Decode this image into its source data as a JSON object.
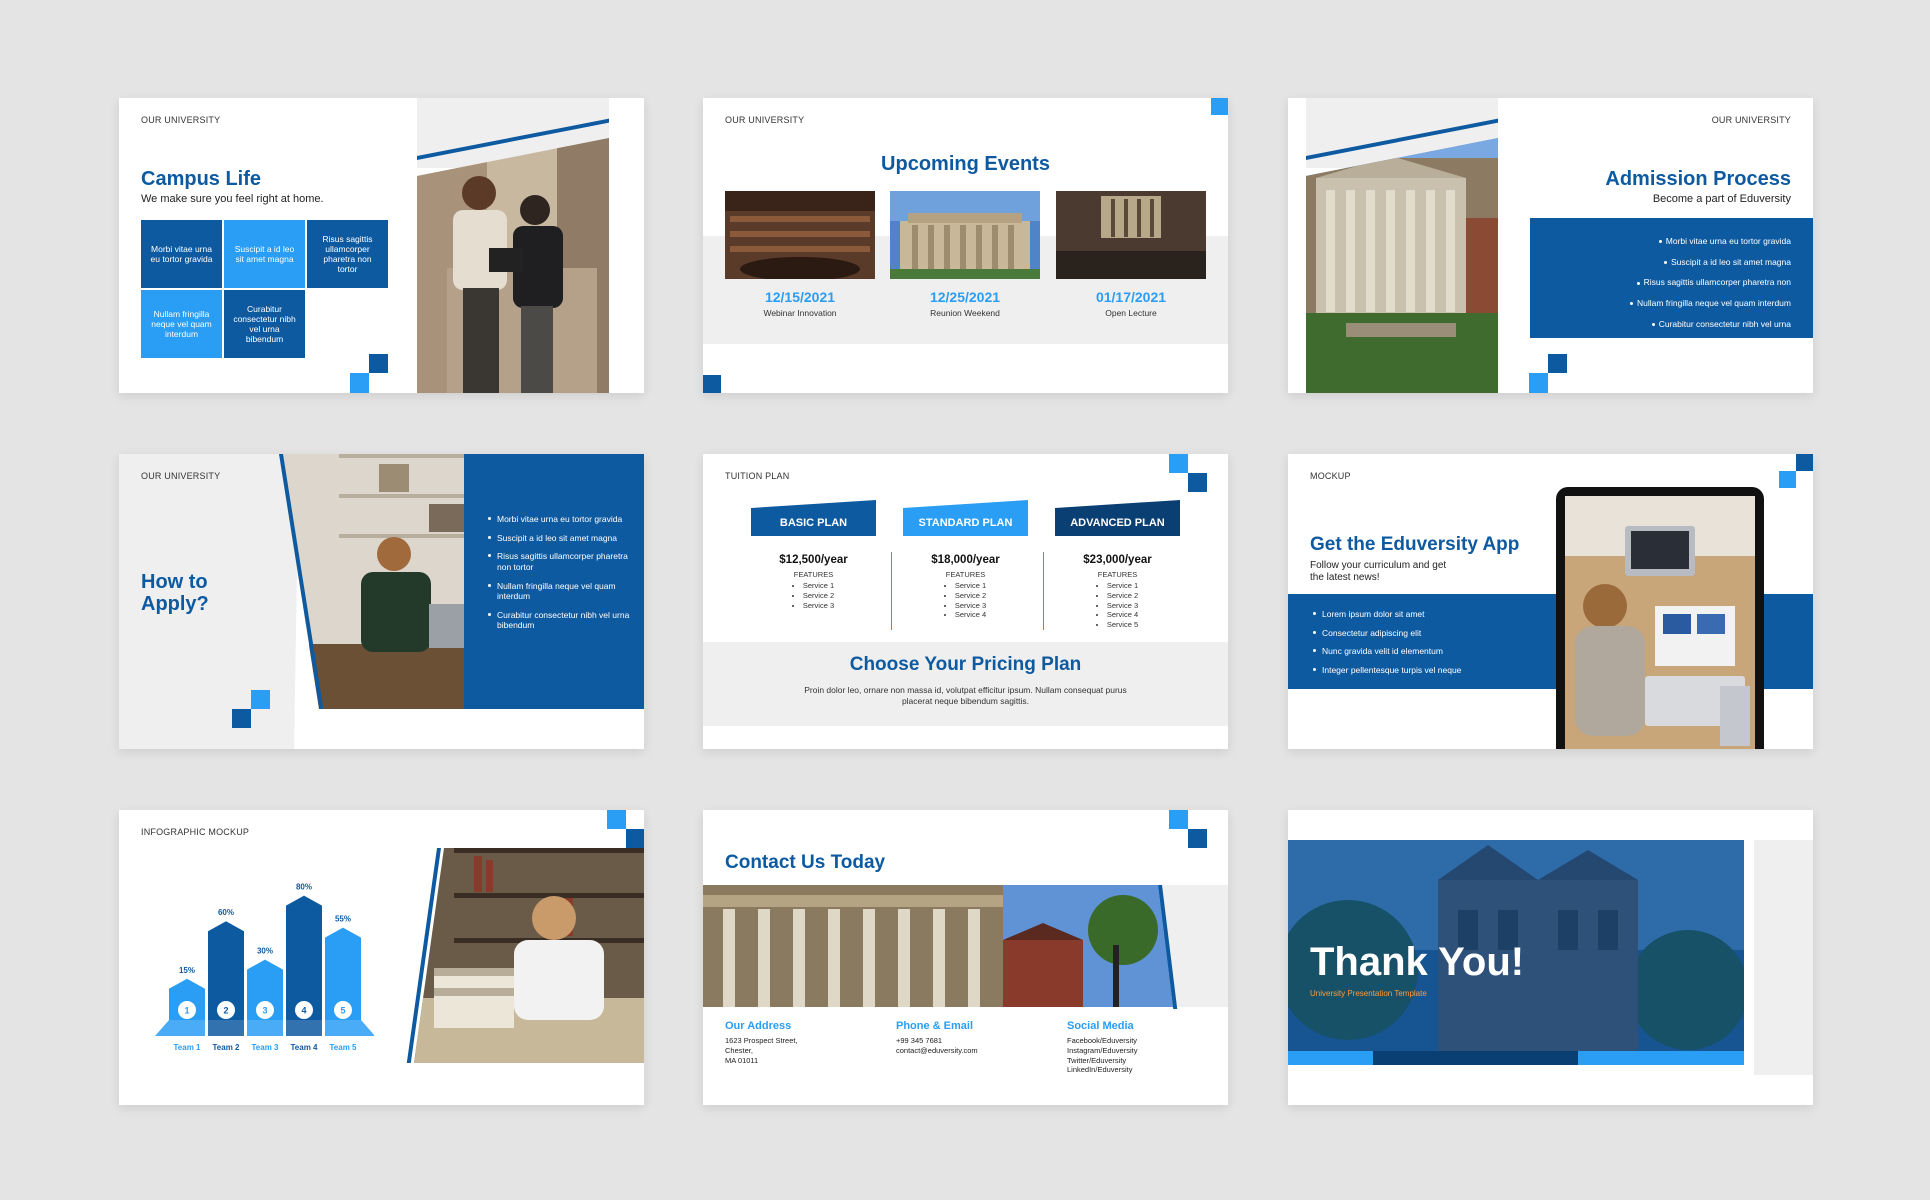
{
  "colors": {
    "dark_blue": "#0e5aa1",
    "light_blue": "#2a9df4",
    "gray": "#efefef",
    "background": "#e4e4e4"
  },
  "s1": {
    "label": "OUR UNIVERSITY",
    "title": "Campus Life",
    "subtitle": "We make sure you feel right at home.",
    "cells": [
      "Morbi vitae urna eu tortor gravida",
      "Suscipit a id leo sit amet magna",
      "Risus sagittis ullamcorper pharetra non tortor",
      "Nullam fringilla neque vel quam interdum",
      "Curabitur consectetur nibh vel urna bibendum"
    ]
  },
  "s2": {
    "label": "OUR UNIVERSITY",
    "title": "Upcoming Events",
    "events": [
      {
        "date": "12/15/2021",
        "name": "Webinar Innovation"
      },
      {
        "date": "12/25/2021",
        "name": "Reunion Weekend"
      },
      {
        "date": "01/17/2021",
        "name": "Open Lecture"
      }
    ]
  },
  "s3": {
    "label": "OUR UNIVERSITY",
    "title": "Admission Process",
    "subtitle": "Become a part of Eduversity",
    "bullets": [
      "Morbi vitae urna eu tortor gravida",
      "Suscipit a id leo sit amet magna",
      "Risus sagittis ullamcorper pharetra non",
      "Nullam fringilla neque vel quam interdum",
      "Curabitur consectetur nibh vel urna"
    ]
  },
  "s4": {
    "label": "OUR UNIVERSITY",
    "title_line1": "How to",
    "title_line2": "Apply?",
    "bullets": [
      "Morbi vitae urna eu tortor gravida",
      "Suscipit a id leo sit amet magna",
      "Risus sagittis ullamcorper pharetra non tortor",
      "Nullam fringilla neque vel quam interdum",
      "Curabitur consectetur nibh vel urna bibendum"
    ]
  },
  "s5": {
    "label": "TUITION PLAN",
    "features_label": "FEATURES",
    "plans": [
      {
        "name": "BASIC PLAN",
        "price": "$12,500/year",
        "services": [
          "Service 1",
          "Service 2",
          "Service 3"
        ]
      },
      {
        "name": "STANDARD PLAN",
        "price": "$18,000/year",
        "services": [
          "Service 1",
          "Service 2",
          "Service 3",
          "Service 4"
        ]
      },
      {
        "name": "ADVANCED PLAN",
        "price": "$23,000/year",
        "services": [
          "Service 1",
          "Service 2",
          "Service 3",
          "Service 4",
          "Service 5"
        ]
      }
    ],
    "heading": "Choose Your Pricing Plan",
    "body": "Proin dolor leo, ornare non massa id, volutpat efficitur ipsum. Nullam consequat purus placerat neque bibendum sagittis."
  },
  "s6": {
    "label": "MOCKUP",
    "title": "Get the Eduversity App",
    "subtitle_line1": "Follow your curriculum and get",
    "subtitle_line2": "the latest news!",
    "bullets": [
      "Lorem ipsum dolor sit amet",
      "Consectetur adipiscing elit",
      "Nunc gravida velit id elementum",
      "Integer pellentesque turpis vel neque"
    ]
  },
  "s7": {
    "label": "INFOGRAPHIC MOCKUP",
    "bars": [
      {
        "team": "Team 1",
        "value": 15,
        "num": "1"
      },
      {
        "team": "Team 2",
        "value": 60,
        "num": "2"
      },
      {
        "team": "Team 3",
        "value": 30,
        "num": "3"
      },
      {
        "team": "Team 4",
        "value": 80,
        "num": "4"
      },
      {
        "team": "Team 5",
        "value": 55,
        "num": "5"
      }
    ],
    "pct_labels": [
      "15%",
      "60%",
      "30%",
      "80%",
      "55%"
    ]
  },
  "s8": {
    "title": "Contact Us Today",
    "address_head": "Our Address",
    "address": [
      "1623 Prospect Street,",
      "Chester,",
      "MA 01011"
    ],
    "phone_head": "Phone & Email",
    "phone": [
      "+99 345 7681",
      "contact@eduversity.com"
    ],
    "social_head": "Social Media",
    "social": [
      "Facebook/Eduversity",
      "Instagram/Eduversity",
      "Twitter/Eduversity",
      "LinkedIn/Eduversity"
    ]
  },
  "s9": {
    "title": "Thank You!",
    "subtitle": "University Presentation Template"
  }
}
